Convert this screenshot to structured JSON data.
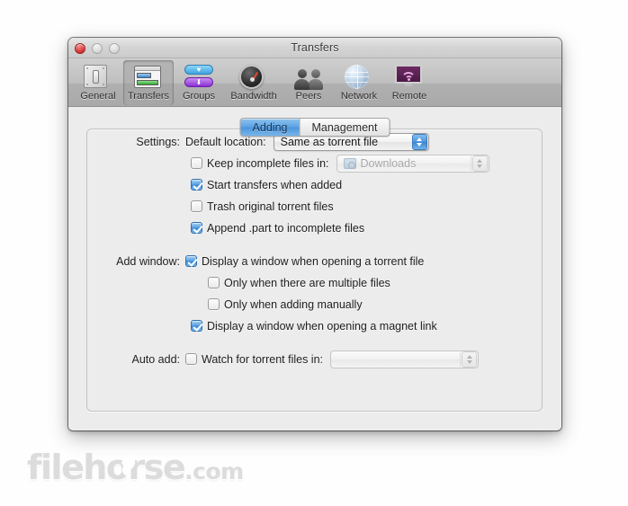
{
  "window": {
    "title": "Transfers",
    "traffic_lights": [
      "close",
      "minimize",
      "zoom"
    ]
  },
  "toolbar": {
    "items": [
      {
        "label": "General",
        "icon": "switch-plate-icon",
        "selected": false
      },
      {
        "label": "Transfers",
        "icon": "transfers-list-icon",
        "selected": true
      },
      {
        "label": "Groups",
        "icon": "group-pills-icon",
        "selected": false
      },
      {
        "label": "Bandwidth",
        "icon": "gauge-icon",
        "selected": false
      },
      {
        "label": "Peers",
        "icon": "people-icon",
        "selected": false
      },
      {
        "label": "Network",
        "icon": "globe-icon",
        "selected": false
      },
      {
        "label": "Remote",
        "icon": "display-wifi-icon",
        "selected": false
      }
    ]
  },
  "tabs": [
    {
      "label": "Adding",
      "active": true
    },
    {
      "label": "Management",
      "active": false
    }
  ],
  "form": {
    "settings_label": "Settings:",
    "default_location_label": "Default location:",
    "default_location_value": "Same as torrent file",
    "keep_incomplete_label": "Keep incomplete files in:",
    "keep_incomplete_checked": false,
    "keep_incomplete_value": "Downloads",
    "start_transfers_label": "Start transfers when added",
    "start_transfers_checked": true,
    "trash_original_label": "Trash original torrent files",
    "trash_original_checked": false,
    "append_part_label": "Append .part to incomplete files",
    "append_part_checked": true,
    "add_window_label": "Add window:",
    "display_torrent_label": "Display a window when opening a torrent file",
    "display_torrent_checked": true,
    "only_multiple_label": "Only when there are multiple files",
    "only_multiple_checked": false,
    "only_manual_label": "Only when adding manually",
    "only_manual_checked": false,
    "display_magnet_label": "Display a window when opening a magnet link",
    "display_magnet_checked": true,
    "auto_add_label": "Auto add:",
    "watch_folder_label": "Watch for torrent files in:",
    "watch_folder_checked": false,
    "watch_folder_value": ""
  },
  "watermark": {
    "text": "filehorse",
    "suffix": ".com"
  },
  "colors": {
    "accent_blue": "#4b95dd",
    "window_bg": "#ececec",
    "toolbar_top": "#cfcfcf",
    "toolbar_bottom": "#a9a9a9",
    "close_red": "#e04a4a",
    "watermark_gray": "#dcdcdc"
  }
}
